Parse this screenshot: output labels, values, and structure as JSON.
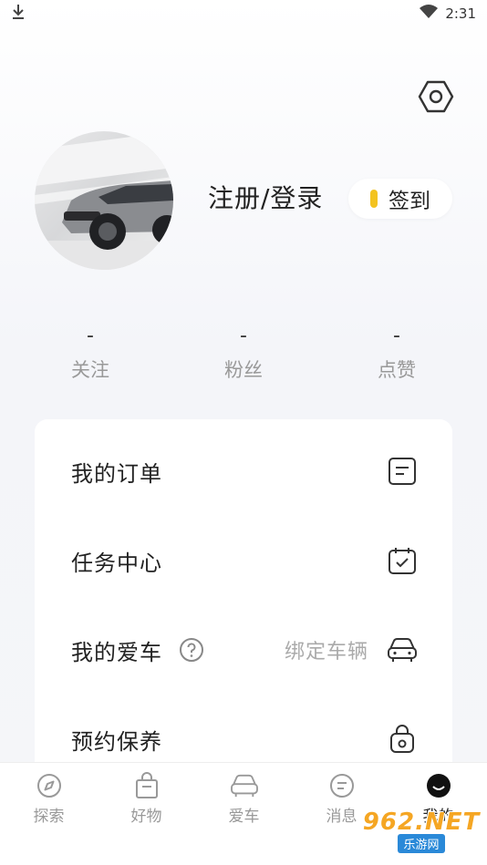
{
  "status_bar": {
    "time": "2:31"
  },
  "profile": {
    "login_label": "注册/登录",
    "checkin_label": "签到"
  },
  "stats": [
    {
      "value": "-",
      "label": "关注"
    },
    {
      "value": "-",
      "label": "粉丝"
    },
    {
      "value": "-",
      "label": "点赞"
    }
  ],
  "menu": [
    {
      "title": "我的订单",
      "hint": "",
      "icon": "order-list-icon"
    },
    {
      "title": "任务中心",
      "hint": "",
      "icon": "calendar-check-icon"
    },
    {
      "title": "我的爱车",
      "hint": "绑定车辆",
      "icon": "car-icon"
    },
    {
      "title": "预约保养",
      "hint": "",
      "icon": "maintenance-bag-icon"
    }
  ],
  "tabs": [
    {
      "label": "探索",
      "icon": "compass-icon"
    },
    {
      "label": "好物",
      "icon": "shopping-bag-icon"
    },
    {
      "label": "爱车",
      "icon": "car-icon"
    },
    {
      "label": "消息",
      "icon": "message-icon"
    },
    {
      "label": "我的",
      "icon": "profile-icon"
    }
  ],
  "active_tab": 4,
  "watermark": {
    "big": "962.NET",
    "small": "乐游网"
  },
  "colors": {
    "accent_coin": "#f3c320",
    "muted_text": "#999999",
    "card_bg": "#ffffff"
  }
}
